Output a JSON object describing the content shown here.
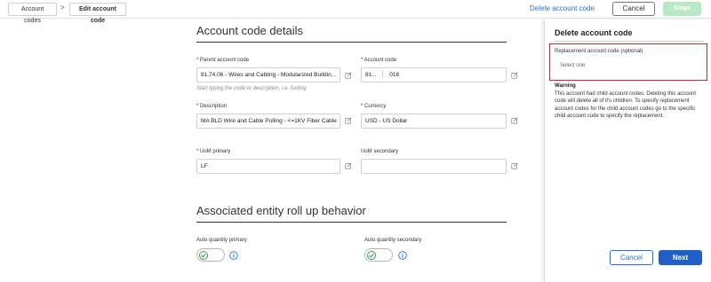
{
  "breadcrumb": {
    "items": [
      "Account codes",
      "Edit account code"
    ],
    "separator": ">"
  },
  "header": {
    "delete_link": "Delete account code",
    "cancel_label": "Cancel",
    "stage_label": "Stage"
  },
  "details": {
    "title": "Account code details",
    "parent_code": {
      "label": "* Parent account code",
      "value": "81.74.06 - Wires and Cabling - Modularized Buildin...",
      "hint": "Start typing the code or description, i.e. footing"
    },
    "account_code": {
      "label": "* Account code",
      "prefix": "81...",
      "value": "016"
    },
    "description": {
      "label": "* Description",
      "value": "MA BLD Wire and Cable Pulling - <=1KV Fiber Cable"
    },
    "currency": {
      "label": "* Currency",
      "value": "USD - US Dollar"
    },
    "uom_primary": {
      "label": "* UoM primary",
      "value": "LF"
    },
    "uom_secondary": {
      "label": "UoM secondary",
      "value": ""
    }
  },
  "rollup": {
    "title": "Associated entity roll up behavior",
    "auto_qty_primary": {
      "label": "Auto quantity primary",
      "enabled": true
    },
    "auto_qty_secondary": {
      "label": "Auto quantity secondary",
      "enabled": true
    }
  },
  "panel": {
    "title": "Delete account code",
    "replacement_label": "Replacement account code (optional)",
    "replacement_placeholder": "Select one",
    "warning_title": "Warning",
    "warning_text": "This account had child account codes. Deleting this account code will delete all of it's children. To specify replacement account codes for the child account codes go to the specific child account code to specify the replacement.",
    "cancel_label": "Cancel",
    "next_label": "Next"
  },
  "colors": {
    "accent": "#2a6fd6",
    "primary_button": "#1f5fc7",
    "stage_disabled": "#b9e8c4",
    "highlight": "#cc2b2b",
    "toggle_on": "#3a9d4d"
  }
}
